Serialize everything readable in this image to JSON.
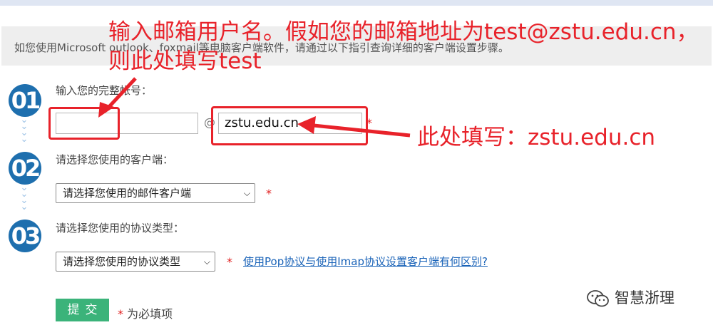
{
  "notice": {
    "text": "如您使用Microsoft outlook、foxmail等电脑客户端软件，请通过以下指引查询详细的客户端设置步骤。"
  },
  "steps": [
    {
      "number": "01",
      "label": "输入您的完整帐号："
    },
    {
      "number": "02",
      "label": "请选择您使用的客户端："
    },
    {
      "number": "03",
      "label": "请选择您使用的协议类型："
    }
  ],
  "account": {
    "username_value": "",
    "at_symbol": "@",
    "domain_value": "zstu.edu.cn",
    "required_mark": "*"
  },
  "client_select": {
    "selected": "请选择您使用的邮件客户端",
    "required_mark": "*"
  },
  "protocol_select": {
    "selected": "请选择您使用的协议类型",
    "required_mark": "*",
    "help_link": "使用Pop协议与使用Imap协议设置客户端有何区别?"
  },
  "form": {
    "submit_label": "提交",
    "required_star": "*",
    "required_note": "为必填项"
  },
  "annotations": {
    "top_line1": "输入邮箱用户名。假如您的邮箱地址为test@zstu.edu.cn，",
    "top_line2": "则此处填写test",
    "right": "此处填写：zstu.edu.cn",
    "color": "#e8222a"
  },
  "watermark": {
    "text": "智慧浙理",
    "icon": "wechat-icon"
  },
  "colors": {
    "step_circle": "#1e6fae",
    "submit_button": "#3bb37a",
    "link": "#1a63b8",
    "required": "#e02020"
  }
}
